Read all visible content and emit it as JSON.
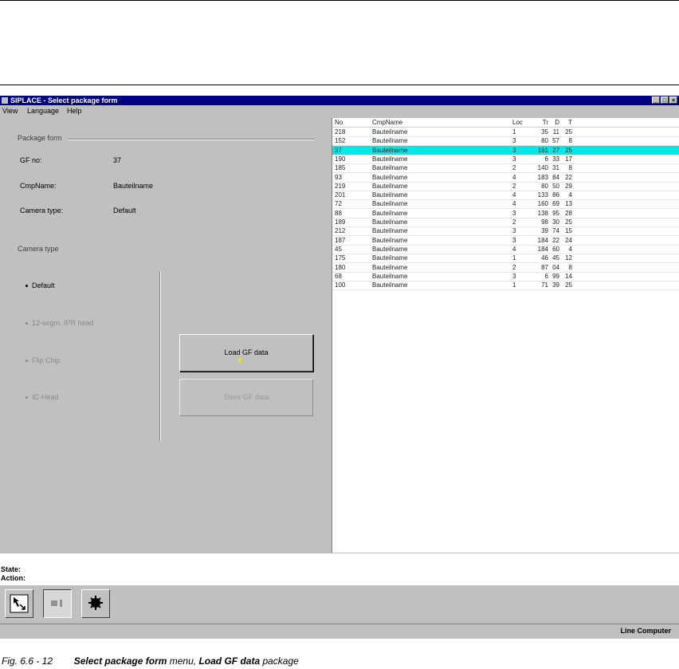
{
  "window": {
    "title": "SIPLACE - Select package form"
  },
  "menu": [
    "View",
    "Language",
    "Help"
  ],
  "form": {
    "group_title": "Package form",
    "gf_label": "GF no:",
    "gf_value": "37",
    "cmp_label": "CmpName:",
    "cmp_value": "Bauteilname",
    "cam_label": "Camera type:",
    "cam_value": "Default"
  },
  "camera": {
    "group_title": "Camera type",
    "options": [
      {
        "label": "Default",
        "enabled": true
      },
      {
        "label": "12-segm. IPR head",
        "enabled": false
      },
      {
        "label": "Flip Chip",
        "enabled": false
      },
      {
        "label": "IC-Head",
        "enabled": false
      }
    ]
  },
  "buttons": {
    "load": "Load GF data",
    "save": "Store GF data"
  },
  "table": {
    "headers": [
      "No",
      "CmpName",
      "Loc",
      "Tr",
      "D",
      "T"
    ],
    "rows": [
      [
        "218",
        "Bauteilname",
        "1",
        "35",
        "11",
        "25"
      ],
      [
        "152",
        "Bauteilname",
        "3",
        "80",
        "57",
        "8"
      ],
      [
        "37",
        "Bauteilname",
        "3",
        "161",
        "27",
        "25"
      ],
      [
        "190",
        "Bauteilname",
        "3",
        "6",
        "33",
        "17"
      ],
      [
        "185",
        "Bauteilname",
        "2",
        "140",
        "31",
        "8"
      ],
      [
        "93",
        "Bauteilname",
        "4",
        "183",
        "84",
        "22"
      ],
      [
        "219",
        "Bauteilname",
        "2",
        "80",
        "50",
        "29"
      ],
      [
        "201",
        "Bauteilname",
        "4",
        "133",
        "86",
        "4"
      ],
      [
        "72",
        "Bauteilname",
        "4",
        "160",
        "69",
        "13"
      ],
      [
        "88",
        "Bauteilname",
        "3",
        "138",
        "95",
        "28"
      ],
      [
        "189",
        "Bauteilname",
        "2",
        "98",
        "30",
        "25"
      ],
      [
        "212",
        "Bauteilname",
        "3",
        "39",
        "74",
        "15"
      ],
      [
        "187",
        "Bauteilname",
        "3",
        "184",
        "22",
        "24"
      ],
      [
        "45",
        "Bauteilname",
        "4",
        "184",
        "60",
        "4"
      ],
      [
        "175",
        "Bauteilname",
        "1",
        "46",
        "45",
        "12"
      ],
      [
        "180",
        "Bauteilname",
        "2",
        "87",
        "04",
        "8"
      ],
      [
        "68",
        "Bauteilname",
        "3",
        "6",
        "99",
        "14"
      ],
      [
        "100",
        "Bauteilname",
        "1",
        "71",
        "39",
        "25"
      ]
    ],
    "selected_index": 2
  },
  "status": {
    "state_label": "State:",
    "action_label": "Action:"
  },
  "statusbar": {
    "text": "Line Computer"
  },
  "caption": {
    "fig": "Fig. 6.6 - 12",
    "bold1": "Select package form",
    "mid": " menu, ",
    "bold2": "Load GF data",
    "end": " package"
  },
  "colors": {
    "title_bar": "#000080",
    "selection": "#00e8e8",
    "window": "#c0c0c0"
  }
}
